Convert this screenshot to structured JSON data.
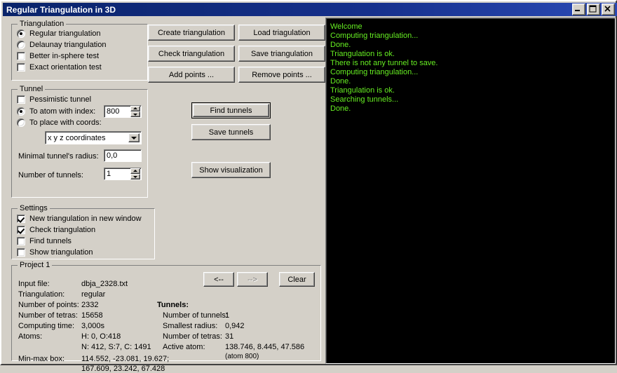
{
  "window": {
    "title": "Regular Triangulation in 3D",
    "buttons": {
      "minimize": "minimize-icon",
      "maximize": "maximize-icon",
      "close": "close-icon"
    }
  },
  "triangulation_group": {
    "title": "Triangulation",
    "options": [
      {
        "label": "Regular triangulation",
        "type": "radio",
        "checked": true
      },
      {
        "label": "Delaunay triangulation",
        "type": "radio",
        "checked": false
      },
      {
        "label": "Better in-sphere test",
        "type": "checkbox",
        "checked": false
      },
      {
        "label": "Exact orientation test",
        "type": "checkbox",
        "checked": false
      }
    ]
  },
  "tunnel_group": {
    "title": "Tunnel",
    "pessimistic_label": "Pessimistic tunnel",
    "pessimistic_checked": false,
    "to_atom_label": "To atom with index:",
    "to_atom_checked": true,
    "to_atom_value": "800",
    "to_place_label": "To place with coords:",
    "to_place_checked": false,
    "coords_combo_value": "x y z coordinates",
    "radius_label": "Minimal tunnel's radius:",
    "radius_value": "0,0",
    "count_label": "Number of tunnels:",
    "count_value": "1"
  },
  "settings_group": {
    "title": "Settings",
    "options": [
      {
        "label": "New triangulation in new window",
        "checked": true
      },
      {
        "label": "Check triangulation",
        "checked": true
      },
      {
        "label": "Find tunnels",
        "checked": false
      },
      {
        "label": "Show triangulation",
        "checked": false
      }
    ]
  },
  "action_buttons": {
    "create_triangulation": "Create triangulation",
    "load_triangulation": "Load triagulation",
    "check_triangulation": "Check triangulation",
    "save_triangulation": "Save triangulation",
    "add_points": "Add points ...",
    "remove_points": "Remove points ...",
    "find_tunnels": "Find tunnels",
    "save_tunnels": "Save tunnels",
    "show_visualization": "Show visualization"
  },
  "project_group": {
    "title": "Project 1",
    "nav": {
      "prev": "<--",
      "next": "-->",
      "next_disabled": true,
      "clear": "Clear"
    },
    "left_fields": [
      {
        "label": "Input file:",
        "value": "dbja_2328.txt"
      },
      {
        "label": "Triangulation:",
        "value": "regular"
      },
      {
        "label": "Number of points:",
        "value": "2332"
      },
      {
        "label": "Number of tetras:",
        "value": "15658"
      },
      {
        "label": "Computing time:",
        "value": "3,000s"
      },
      {
        "label": "Atoms:",
        "value": "H: 0, O:418"
      },
      {
        "label": "",
        "value": "N: 412, S:7, C: 1491"
      },
      {
        "label": "Min-max box:",
        "value": "114.552, -23.081, 19.627;"
      },
      {
        "label": "",
        "value": "167.609, 23.242, 67.428"
      }
    ],
    "tunnels_heading": "Tunnels:",
    "right_fields": [
      {
        "label": "Number of tunnels:",
        "value": "1"
      },
      {
        "label": "Smallest radius:",
        "value": "0,942"
      },
      {
        "label": "Number of tetras:",
        "value": "31"
      },
      {
        "label": "Active atom:",
        "value": "138.746, 8.445, 47.586"
      },
      {
        "label": "",
        "value": "(atom 800)"
      }
    ]
  },
  "console": {
    "text_color": "#66ee22",
    "background_color": "#000000",
    "lines": [
      "Welcome",
      "Computing triangulation...",
      "Done.",
      "Triangulation is ok.",
      "There is not any tunnel to save.",
      "Computing triangulation...",
      "Done.",
      "Triangulation is ok.",
      "Searching tunnels...",
      "Done."
    ]
  }
}
